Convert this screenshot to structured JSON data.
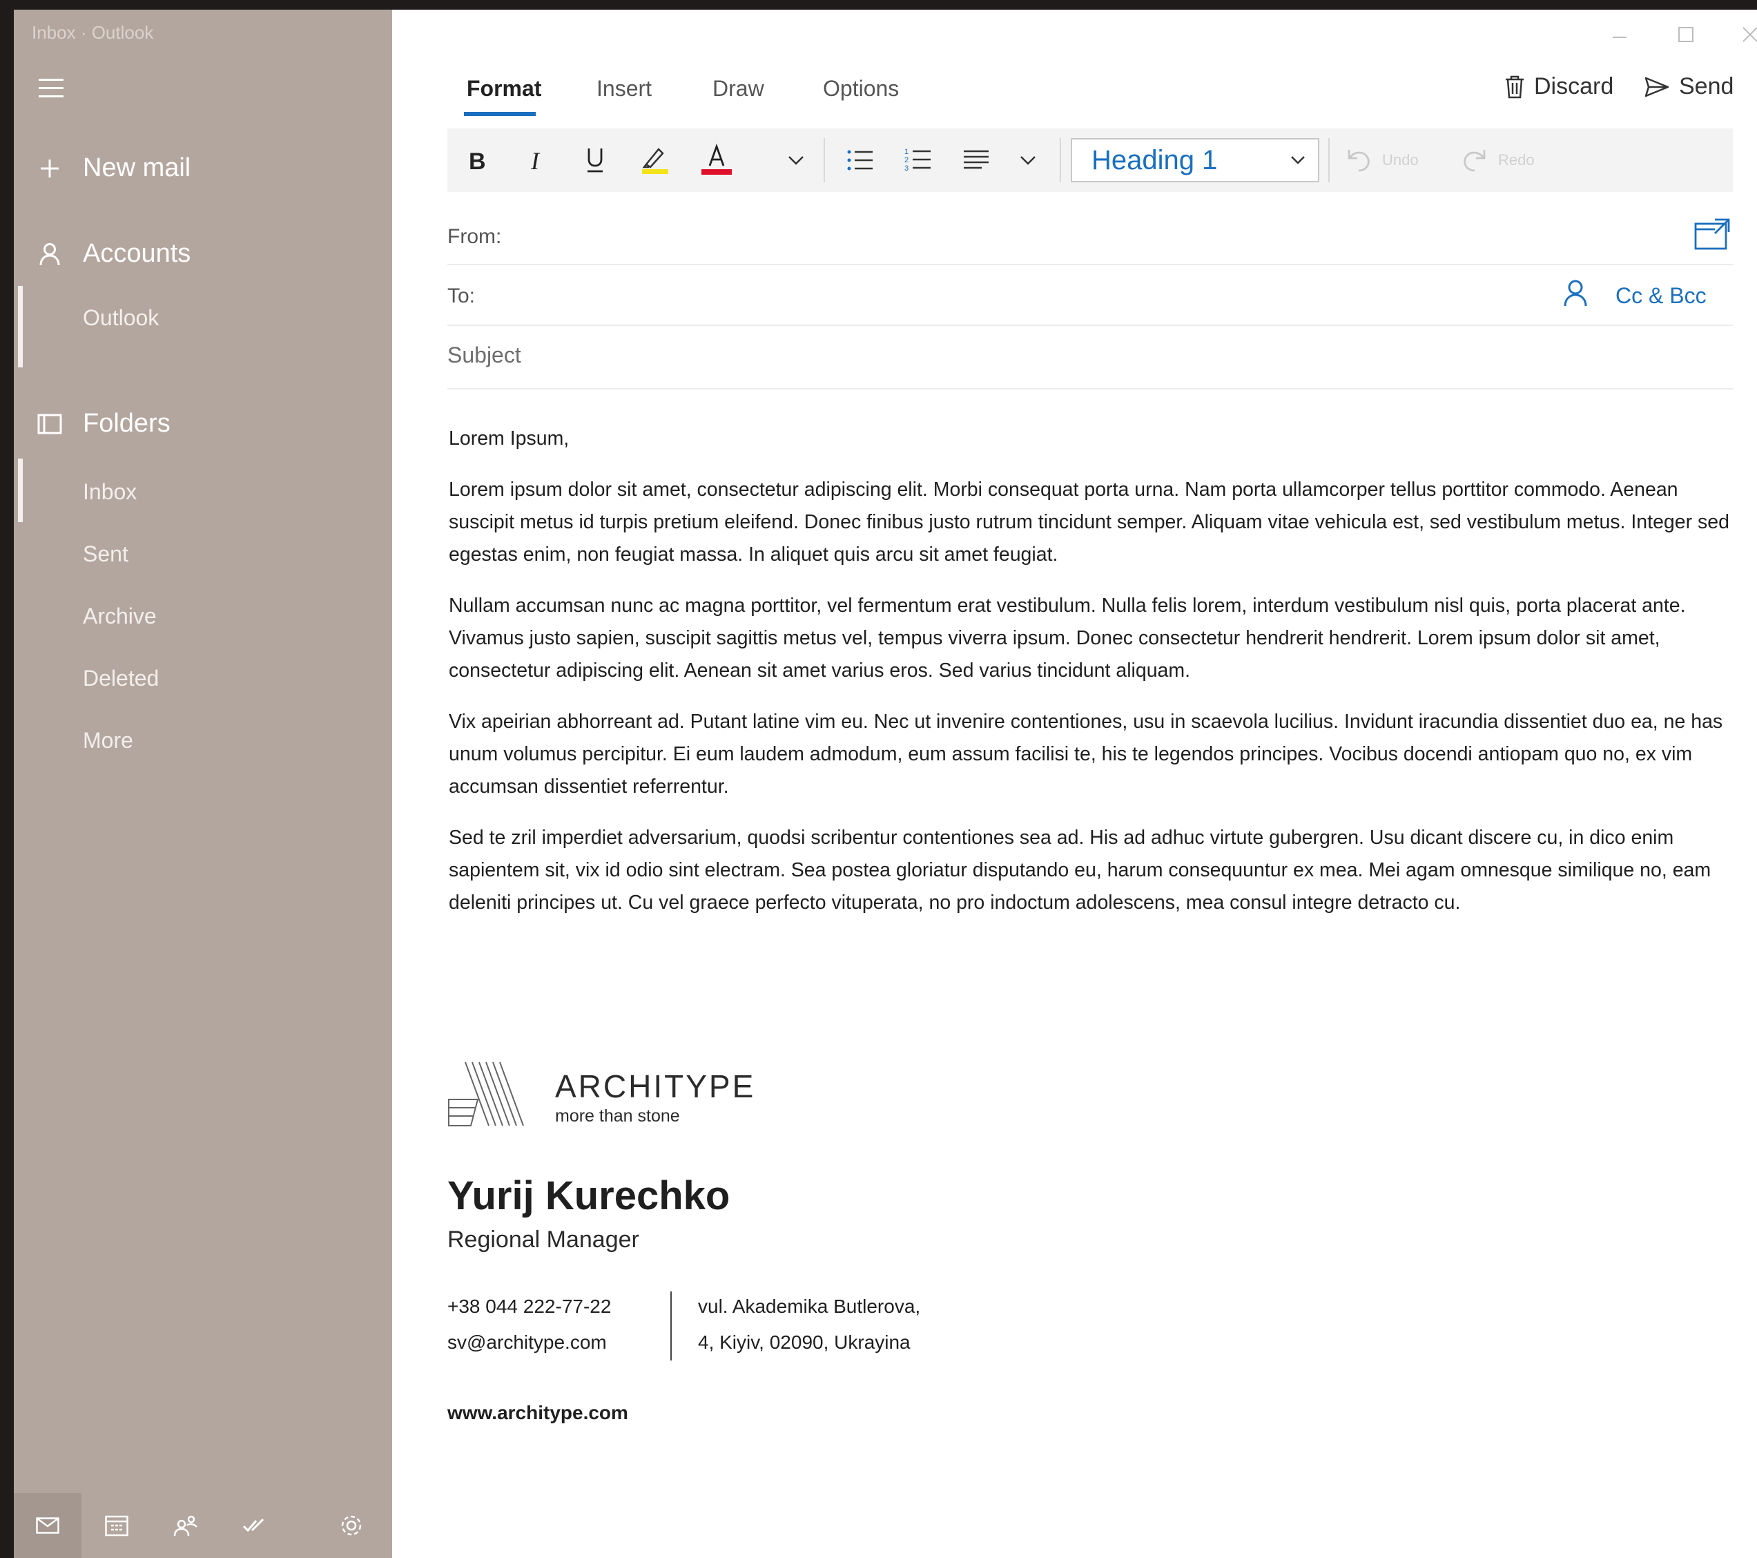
{
  "window": {
    "title": "Inbox · Outlook"
  },
  "sidebar": {
    "new_mail": "New mail",
    "accounts": "Accounts",
    "account_items": [
      "Outlook"
    ],
    "folders": "Folders",
    "folder_items": [
      "Inbox",
      "Sent",
      "Archive",
      "Deleted",
      "More"
    ],
    "selected_folder": "Inbox",
    "bottom_icons": [
      "mail-icon",
      "calendar-icon",
      "people-icon",
      "todo-icon",
      "settings-icon"
    ]
  },
  "tabs": [
    "Format",
    "Insert",
    "Draw",
    "Options"
  ],
  "active_tab": "Format",
  "commands": {
    "discard": "Discard",
    "send": "Send"
  },
  "ribbon": {
    "style_value": "Heading 1",
    "undo": "Undo",
    "redo": "Redo",
    "highlight_color": "#f5e31a",
    "font_color": "#e0102a"
  },
  "fields": {
    "from_label": "From:",
    "to_label": "To:",
    "cc_bcc": "Cc & Bcc",
    "subject_placeholder": "Subject"
  },
  "body": {
    "greeting": "Lorem Ipsum,",
    "paragraphs": [
      "Lorem ipsum dolor sit amet, consectetur adipiscing elit. Morbi consequat porta urna. Nam porta ullamcorper tellus porttitor commodo. Aenean suscipit metus id turpis pretium eleifend. Donec finibus justo rutrum tincidunt semper. Aliquam vitae vehicula est, sed vestibulum metus. Integer sed egestas enim, non feugiat massa. In aliquet quis arcu sit amet feugiat.",
      "Nullam accumsan nunc ac magna porttitor, vel fermentum erat vestibulum. Nulla felis lorem, interdum vestibulum nisl quis, porta placerat ante. Vivamus justo sapien, suscipit sagittis metus vel, tempus viverra ipsum. Donec consectetur hendrerit hendrerit. Lorem ipsum dolor sit amet, consectetur adipiscing elit. Aenean sit amet varius eros. Sed varius tincidunt aliquam.",
      "Vix apeirian abhorreant ad. Putant latine vim eu. Nec ut invenire contentiones, usu in scaevola lucilius. Invidunt iracundia dissentiet duo ea, ne has unum volumus percipitur. Ei eum laudem admodum, eum assum facilisi te, his te legendos principes. Vocibus docendi antiopam quo no, ex vim accumsan dissentiet referrentur.",
      "Sed te zril imperdiet adversarium, quodsi scribentur contentiones sea ad. His ad adhuc virtute gubergren. Usu dicant discere cu, in dico enim sapientem sit, vix id odio sint electram. Sea postea gloriatur disputando eu, harum consequuntur ex mea. Mei agam omnesque similique no, eam deleniti principes ut. Cu vel graece perfecto vituperata, no pro indoctum adolescens, mea consul integre detracto cu."
    ]
  },
  "signature": {
    "brand": "ARCHITYPE",
    "tagline": "more than stone",
    "name": "Yurij Kurechko",
    "role": "Regional Manager",
    "phone": "+38  044 222-77-22",
    "email": "sv@architype.com",
    "address_line1": "vul. Akademika Butlerova,",
    "address_line2": "4, Kiyiv, 02090, Ukrayina",
    "website": "www.architype.com"
  }
}
